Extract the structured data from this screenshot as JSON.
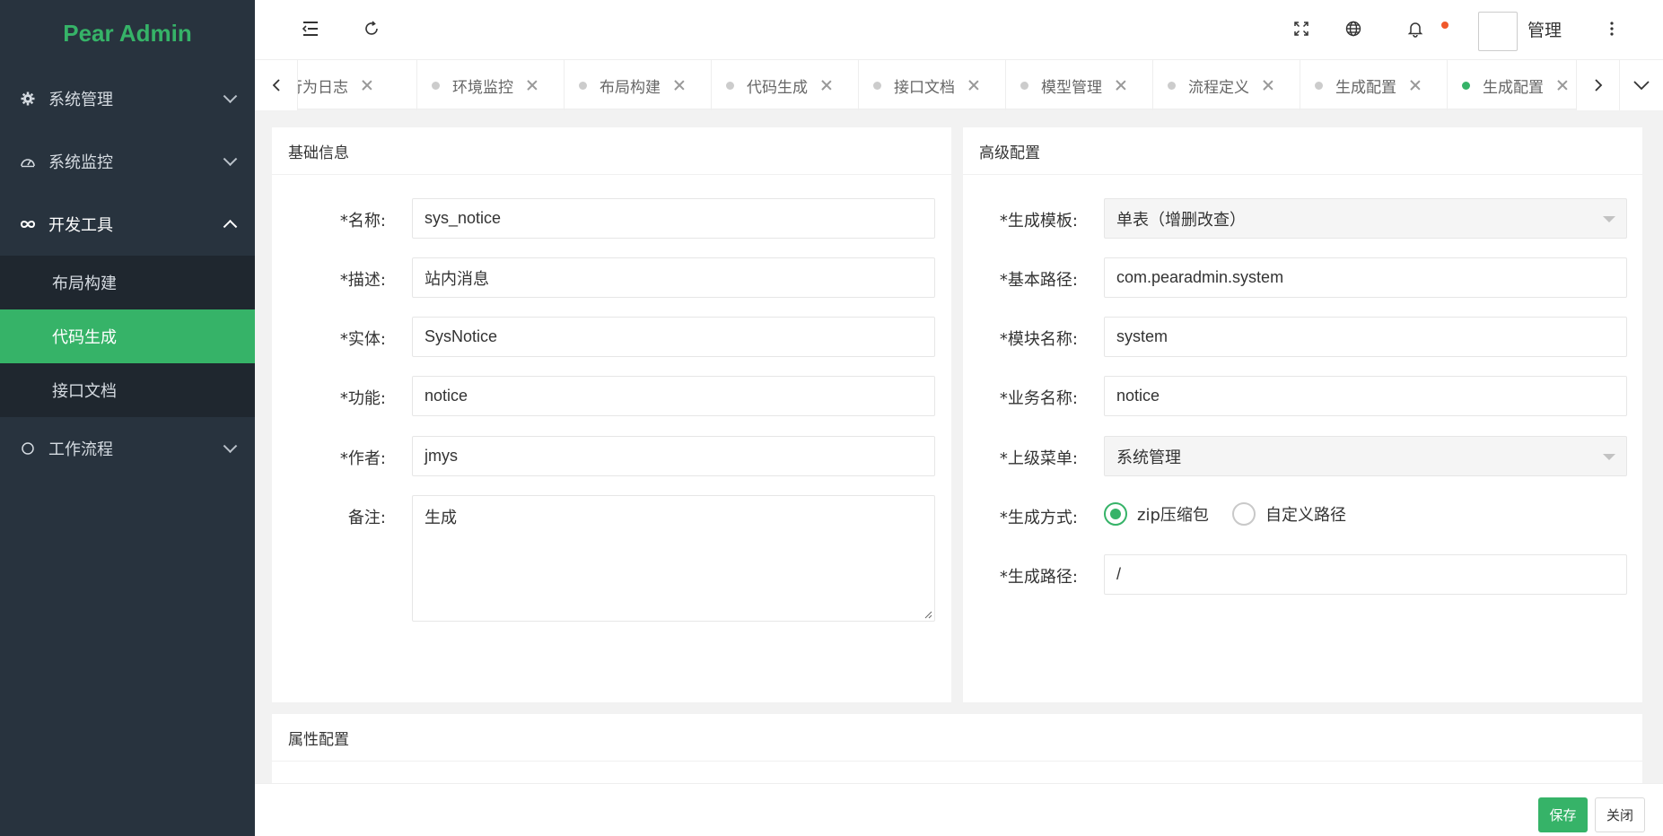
{
  "app": {
    "logo": "Pear Admin"
  },
  "sidebar": {
    "items": [
      {
        "label": "系统管理",
        "icon": "gear-icon"
      },
      {
        "label": "系统监控",
        "icon": "dashboard-icon"
      },
      {
        "label": "开发工具",
        "icon": "infinity-icon",
        "open": true,
        "children": [
          {
            "label": "布局构建"
          },
          {
            "label": "代码生成",
            "active": true
          },
          {
            "label": "接口文档"
          }
        ]
      },
      {
        "label": "工作流程",
        "icon": "circle-icon"
      }
    ]
  },
  "header": {
    "user_name": "管理"
  },
  "tabs": [
    {
      "label": "行为日志"
    },
    {
      "label": "环境监控"
    },
    {
      "label": "布局构建"
    },
    {
      "label": "代码生成"
    },
    {
      "label": "接口文档"
    },
    {
      "label": "模型管理"
    },
    {
      "label": "流程定义"
    },
    {
      "label": "生成配置"
    },
    {
      "label": "生成配置",
      "active": true
    }
  ],
  "basic": {
    "title": "基础信息",
    "fields": [
      {
        "label": "*名称:",
        "value": "sys_notice"
      },
      {
        "label": "*描述:",
        "value": "站内消息"
      },
      {
        "label": "*实体:",
        "value": "SysNotice"
      },
      {
        "label": "*功能:",
        "value": "notice"
      },
      {
        "label": "*作者:",
        "value": "jmys"
      },
      {
        "label": "备注:",
        "value": "生成"
      }
    ]
  },
  "advanced": {
    "title": "高级配置",
    "fields": [
      {
        "label": "*生成模板:",
        "value": "单表（增删改查）"
      },
      {
        "label": "*基本路径:",
        "value": "com.pearadmin.system"
      },
      {
        "label": "*模块名称:",
        "value": "system"
      },
      {
        "label": "*业务名称:",
        "value": "notice"
      },
      {
        "label": "*上级菜单:",
        "value": "系统管理"
      },
      {
        "label": "*生成方式:"
      },
      {
        "label": "*生成路径:",
        "value": "/"
      }
    ],
    "radio_options": [
      {
        "label": "zip压缩包",
        "checked": true
      },
      {
        "label": "自定义路径",
        "checked": false
      }
    ]
  },
  "attributes": {
    "title": "属性配置"
  },
  "footer": {
    "save_label": "保存",
    "close_label": "关闭"
  },
  "colors": {
    "primary": "#36b368",
    "sidebar_bg": "#28333e",
    "badge": "#f0582b"
  }
}
